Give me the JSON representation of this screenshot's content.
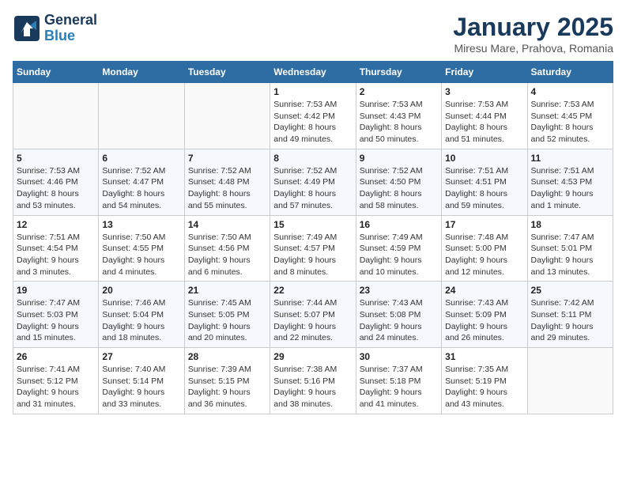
{
  "header": {
    "logo_line1": "General",
    "logo_line2": "Blue",
    "month": "January 2025",
    "location": "Miresu Mare, Prahova, Romania"
  },
  "weekdays": [
    "Sunday",
    "Monday",
    "Tuesday",
    "Wednesday",
    "Thursday",
    "Friday",
    "Saturday"
  ],
  "weeks": [
    [
      {
        "day": "",
        "info": ""
      },
      {
        "day": "",
        "info": ""
      },
      {
        "day": "",
        "info": ""
      },
      {
        "day": "1",
        "info": "Sunrise: 7:53 AM\nSunset: 4:42 PM\nDaylight: 8 hours\nand 49 minutes."
      },
      {
        "day": "2",
        "info": "Sunrise: 7:53 AM\nSunset: 4:43 PM\nDaylight: 8 hours\nand 50 minutes."
      },
      {
        "day": "3",
        "info": "Sunrise: 7:53 AM\nSunset: 4:44 PM\nDaylight: 8 hours\nand 51 minutes."
      },
      {
        "day": "4",
        "info": "Sunrise: 7:53 AM\nSunset: 4:45 PM\nDaylight: 8 hours\nand 52 minutes."
      }
    ],
    [
      {
        "day": "5",
        "info": "Sunrise: 7:53 AM\nSunset: 4:46 PM\nDaylight: 8 hours\nand 53 minutes."
      },
      {
        "day": "6",
        "info": "Sunrise: 7:52 AM\nSunset: 4:47 PM\nDaylight: 8 hours\nand 54 minutes."
      },
      {
        "day": "7",
        "info": "Sunrise: 7:52 AM\nSunset: 4:48 PM\nDaylight: 8 hours\nand 55 minutes."
      },
      {
        "day": "8",
        "info": "Sunrise: 7:52 AM\nSunset: 4:49 PM\nDaylight: 8 hours\nand 57 minutes."
      },
      {
        "day": "9",
        "info": "Sunrise: 7:52 AM\nSunset: 4:50 PM\nDaylight: 8 hours\nand 58 minutes."
      },
      {
        "day": "10",
        "info": "Sunrise: 7:51 AM\nSunset: 4:51 PM\nDaylight: 8 hours\nand 59 minutes."
      },
      {
        "day": "11",
        "info": "Sunrise: 7:51 AM\nSunset: 4:53 PM\nDaylight: 9 hours\nand 1 minute."
      }
    ],
    [
      {
        "day": "12",
        "info": "Sunrise: 7:51 AM\nSunset: 4:54 PM\nDaylight: 9 hours\nand 3 minutes."
      },
      {
        "day": "13",
        "info": "Sunrise: 7:50 AM\nSunset: 4:55 PM\nDaylight: 9 hours\nand 4 minutes."
      },
      {
        "day": "14",
        "info": "Sunrise: 7:50 AM\nSunset: 4:56 PM\nDaylight: 9 hours\nand 6 minutes."
      },
      {
        "day": "15",
        "info": "Sunrise: 7:49 AM\nSunset: 4:57 PM\nDaylight: 9 hours\nand 8 minutes."
      },
      {
        "day": "16",
        "info": "Sunrise: 7:49 AM\nSunset: 4:59 PM\nDaylight: 9 hours\nand 10 minutes."
      },
      {
        "day": "17",
        "info": "Sunrise: 7:48 AM\nSunset: 5:00 PM\nDaylight: 9 hours\nand 12 minutes."
      },
      {
        "day": "18",
        "info": "Sunrise: 7:47 AM\nSunset: 5:01 PM\nDaylight: 9 hours\nand 13 minutes."
      }
    ],
    [
      {
        "day": "19",
        "info": "Sunrise: 7:47 AM\nSunset: 5:03 PM\nDaylight: 9 hours\nand 15 minutes."
      },
      {
        "day": "20",
        "info": "Sunrise: 7:46 AM\nSunset: 5:04 PM\nDaylight: 9 hours\nand 18 minutes."
      },
      {
        "day": "21",
        "info": "Sunrise: 7:45 AM\nSunset: 5:05 PM\nDaylight: 9 hours\nand 20 minutes."
      },
      {
        "day": "22",
        "info": "Sunrise: 7:44 AM\nSunset: 5:07 PM\nDaylight: 9 hours\nand 22 minutes."
      },
      {
        "day": "23",
        "info": "Sunrise: 7:43 AM\nSunset: 5:08 PM\nDaylight: 9 hours\nand 24 minutes."
      },
      {
        "day": "24",
        "info": "Sunrise: 7:43 AM\nSunset: 5:09 PM\nDaylight: 9 hours\nand 26 minutes."
      },
      {
        "day": "25",
        "info": "Sunrise: 7:42 AM\nSunset: 5:11 PM\nDaylight: 9 hours\nand 29 minutes."
      }
    ],
    [
      {
        "day": "26",
        "info": "Sunrise: 7:41 AM\nSunset: 5:12 PM\nDaylight: 9 hours\nand 31 minutes."
      },
      {
        "day": "27",
        "info": "Sunrise: 7:40 AM\nSunset: 5:14 PM\nDaylight: 9 hours\nand 33 minutes."
      },
      {
        "day": "28",
        "info": "Sunrise: 7:39 AM\nSunset: 5:15 PM\nDaylight: 9 hours\nand 36 minutes."
      },
      {
        "day": "29",
        "info": "Sunrise: 7:38 AM\nSunset: 5:16 PM\nDaylight: 9 hours\nand 38 minutes."
      },
      {
        "day": "30",
        "info": "Sunrise: 7:37 AM\nSunset: 5:18 PM\nDaylight: 9 hours\nand 41 minutes."
      },
      {
        "day": "31",
        "info": "Sunrise: 7:35 AM\nSunset: 5:19 PM\nDaylight: 9 hours\nand 43 minutes."
      },
      {
        "day": "",
        "info": ""
      }
    ]
  ]
}
